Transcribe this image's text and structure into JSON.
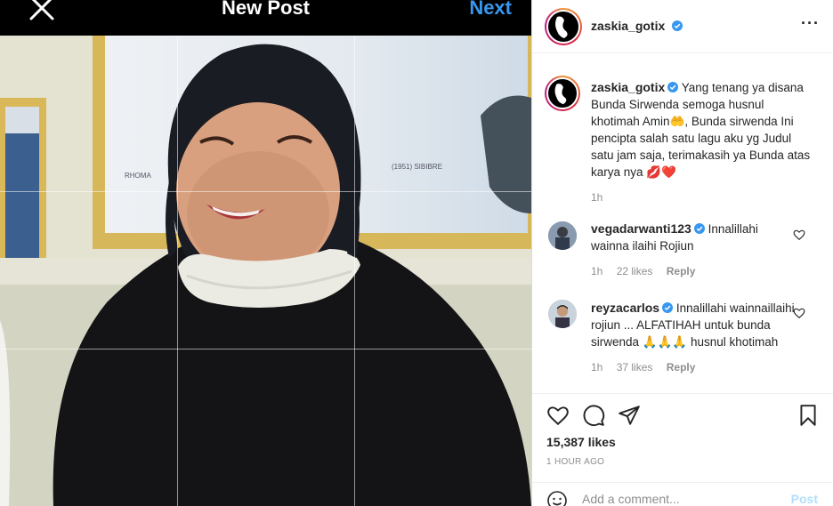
{
  "editor": {
    "title": "New Post",
    "next_label": "Next",
    "close_icon": "close-icon"
  },
  "post": {
    "author": "zaskia_gotix",
    "more_icon": "more-options-icon",
    "caption": {
      "author": "zaskia_gotix",
      "text": "Yang tenang ya disana Bunda Sirwenda semoga husnul khotimah Amin🤲, Bunda sirwenda Ini pencipta salah satu lagu aku yg Judul satu jam saja, terimakasih ya Bunda atas karya nya 💋❤️",
      "time": "1h"
    },
    "comments": [
      {
        "author": "vegadarwanti123",
        "text": "Innalillahi wainna ilaihi Rojiun",
        "time": "1h",
        "likes": "22 likes",
        "reply": "Reply"
      },
      {
        "author": "reyzacarlos",
        "text": "Innalillahi wainnaillaihi rojiun ... ALFATIHAH untuk bunda sirwenda 🙏🙏🙏 husnul khotimah",
        "time": "1h",
        "likes": "37 likes",
        "reply": "Reply"
      }
    ],
    "likes": "15,387 likes",
    "timestamp": "1 HOUR AGO",
    "add_comment_placeholder": "Add a comment...",
    "post_label": "Post"
  },
  "colors": {
    "accent": "#3897f0",
    "verified": "#3897f0",
    "muted": "#8e8e8e",
    "post_disabled": "#b2dffc"
  }
}
